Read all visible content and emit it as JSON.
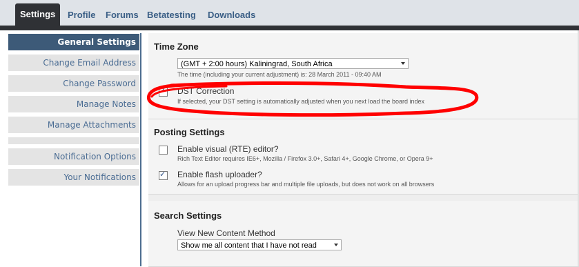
{
  "topnav": {
    "tabs": [
      "Settings",
      "Profile",
      "Forums",
      "Betatesting",
      "Downloads"
    ],
    "active": "Settings"
  },
  "sidebar": {
    "items": [
      {
        "label": "General Settings",
        "active": true
      },
      {
        "label": "Change Email Address"
      },
      {
        "label": "Change Password"
      },
      {
        "label": "Manage Notes"
      },
      {
        "label": "Manage Attachments"
      },
      {
        "label": "Notification Options"
      },
      {
        "label": "Your Notifications"
      }
    ]
  },
  "timezone": {
    "title": "Time Zone",
    "selected": "(GMT + 2:00 hours) Kaliningrad, South Africa",
    "current_time_hint": "The time (including your current adjustment) is: 28 March 2011 - 09:40 AM",
    "dst_label": "DST Correction",
    "dst_checked": true,
    "dst_hint": "If selected, your DST setting is automatically adjusted when you next load the board index"
  },
  "posting": {
    "title": "Posting Settings",
    "rte_label": "Enable visual (RTE) editor?",
    "rte_checked": false,
    "rte_hint": "Rich Text Editor requires IE6+, Mozilla / Firefox 3.0+, Safari 4+, Google Chrome, or Opera 9+",
    "flash_label": "Enable flash uploader?",
    "flash_checked": true,
    "flash_hint": "Allows for an upload progress bar and multiple file uploads, but does not work on all browsers"
  },
  "search": {
    "title": "Search Settings",
    "method_label": "View New Content Method",
    "method_selected": "Show me all content that I have not read"
  },
  "colors": {
    "nav_dark": "#2f3135",
    "sidebar_active": "#3d5a78",
    "link_blue": "#4a6c93",
    "annotation_red": "#ff0000"
  }
}
